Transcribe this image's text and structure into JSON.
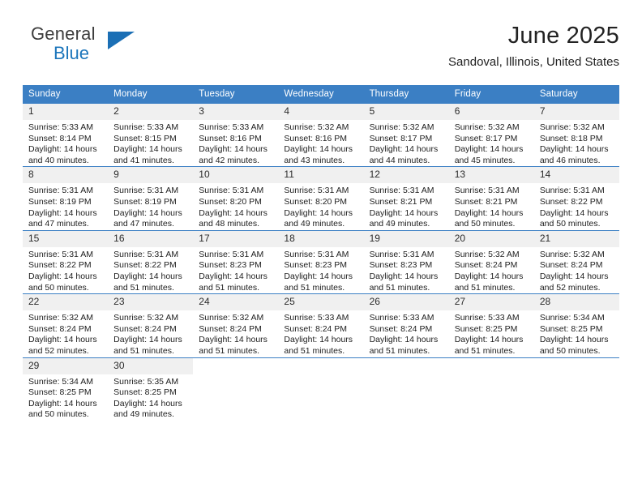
{
  "brand": {
    "line1": "General",
    "line2": "Blue",
    "triangle_color": "#1b6fb5",
    "blue_color": "#1b75bb"
  },
  "header": {
    "title": "June 2025",
    "location": "Sandoval, Illinois, United States"
  },
  "theme": {
    "header_bg": "#3b7fc4",
    "header_text": "#ffffff",
    "daynum_bg": "#f0f0f0",
    "page_bg": "#ffffff",
    "body_text": "#1d1d1d"
  },
  "weekday_headers": [
    "Sunday",
    "Monday",
    "Tuesday",
    "Wednesday",
    "Thursday",
    "Friday",
    "Saturday"
  ],
  "weeks": [
    [
      {
        "day": "1",
        "sunrise": "Sunrise: 5:33 AM",
        "sunset": "Sunset: 8:14 PM",
        "daylight_line1": "Daylight: 14 hours",
        "daylight_line2": "and 40 minutes."
      },
      {
        "day": "2",
        "sunrise": "Sunrise: 5:33 AM",
        "sunset": "Sunset: 8:15 PM",
        "daylight_line1": "Daylight: 14 hours",
        "daylight_line2": "and 41 minutes."
      },
      {
        "day": "3",
        "sunrise": "Sunrise: 5:33 AM",
        "sunset": "Sunset: 8:16 PM",
        "daylight_line1": "Daylight: 14 hours",
        "daylight_line2": "and 42 minutes."
      },
      {
        "day": "4",
        "sunrise": "Sunrise: 5:32 AM",
        "sunset": "Sunset: 8:16 PM",
        "daylight_line1": "Daylight: 14 hours",
        "daylight_line2": "and 43 minutes."
      },
      {
        "day": "5",
        "sunrise": "Sunrise: 5:32 AM",
        "sunset": "Sunset: 8:17 PM",
        "daylight_line1": "Daylight: 14 hours",
        "daylight_line2": "and 44 minutes."
      },
      {
        "day": "6",
        "sunrise": "Sunrise: 5:32 AM",
        "sunset": "Sunset: 8:17 PM",
        "daylight_line1": "Daylight: 14 hours",
        "daylight_line2": "and 45 minutes."
      },
      {
        "day": "7",
        "sunrise": "Sunrise: 5:32 AM",
        "sunset": "Sunset: 8:18 PM",
        "daylight_line1": "Daylight: 14 hours",
        "daylight_line2": "and 46 minutes."
      }
    ],
    [
      {
        "day": "8",
        "sunrise": "Sunrise: 5:31 AM",
        "sunset": "Sunset: 8:19 PM",
        "daylight_line1": "Daylight: 14 hours",
        "daylight_line2": "and 47 minutes."
      },
      {
        "day": "9",
        "sunrise": "Sunrise: 5:31 AM",
        "sunset": "Sunset: 8:19 PM",
        "daylight_line1": "Daylight: 14 hours",
        "daylight_line2": "and 47 minutes."
      },
      {
        "day": "10",
        "sunrise": "Sunrise: 5:31 AM",
        "sunset": "Sunset: 8:20 PM",
        "daylight_line1": "Daylight: 14 hours",
        "daylight_line2": "and 48 minutes."
      },
      {
        "day": "11",
        "sunrise": "Sunrise: 5:31 AM",
        "sunset": "Sunset: 8:20 PM",
        "daylight_line1": "Daylight: 14 hours",
        "daylight_line2": "and 49 minutes."
      },
      {
        "day": "12",
        "sunrise": "Sunrise: 5:31 AM",
        "sunset": "Sunset: 8:21 PM",
        "daylight_line1": "Daylight: 14 hours",
        "daylight_line2": "and 49 minutes."
      },
      {
        "day": "13",
        "sunrise": "Sunrise: 5:31 AM",
        "sunset": "Sunset: 8:21 PM",
        "daylight_line1": "Daylight: 14 hours",
        "daylight_line2": "and 50 minutes."
      },
      {
        "day": "14",
        "sunrise": "Sunrise: 5:31 AM",
        "sunset": "Sunset: 8:22 PM",
        "daylight_line1": "Daylight: 14 hours",
        "daylight_line2": "and 50 minutes."
      }
    ],
    [
      {
        "day": "15",
        "sunrise": "Sunrise: 5:31 AM",
        "sunset": "Sunset: 8:22 PM",
        "daylight_line1": "Daylight: 14 hours",
        "daylight_line2": "and 50 minutes."
      },
      {
        "day": "16",
        "sunrise": "Sunrise: 5:31 AM",
        "sunset": "Sunset: 8:22 PM",
        "daylight_line1": "Daylight: 14 hours",
        "daylight_line2": "and 51 minutes."
      },
      {
        "day": "17",
        "sunrise": "Sunrise: 5:31 AM",
        "sunset": "Sunset: 8:23 PM",
        "daylight_line1": "Daylight: 14 hours",
        "daylight_line2": "and 51 minutes."
      },
      {
        "day": "18",
        "sunrise": "Sunrise: 5:31 AM",
        "sunset": "Sunset: 8:23 PM",
        "daylight_line1": "Daylight: 14 hours",
        "daylight_line2": "and 51 minutes."
      },
      {
        "day": "19",
        "sunrise": "Sunrise: 5:31 AM",
        "sunset": "Sunset: 8:23 PM",
        "daylight_line1": "Daylight: 14 hours",
        "daylight_line2": "and 51 minutes."
      },
      {
        "day": "20",
        "sunrise": "Sunrise: 5:32 AM",
        "sunset": "Sunset: 8:24 PM",
        "daylight_line1": "Daylight: 14 hours",
        "daylight_line2": "and 51 minutes."
      },
      {
        "day": "21",
        "sunrise": "Sunrise: 5:32 AM",
        "sunset": "Sunset: 8:24 PM",
        "daylight_line1": "Daylight: 14 hours",
        "daylight_line2": "and 52 minutes."
      }
    ],
    [
      {
        "day": "22",
        "sunrise": "Sunrise: 5:32 AM",
        "sunset": "Sunset: 8:24 PM",
        "daylight_line1": "Daylight: 14 hours",
        "daylight_line2": "and 52 minutes."
      },
      {
        "day": "23",
        "sunrise": "Sunrise: 5:32 AM",
        "sunset": "Sunset: 8:24 PM",
        "daylight_line1": "Daylight: 14 hours",
        "daylight_line2": "and 51 minutes."
      },
      {
        "day": "24",
        "sunrise": "Sunrise: 5:32 AM",
        "sunset": "Sunset: 8:24 PM",
        "daylight_line1": "Daylight: 14 hours",
        "daylight_line2": "and 51 minutes."
      },
      {
        "day": "25",
        "sunrise": "Sunrise: 5:33 AM",
        "sunset": "Sunset: 8:24 PM",
        "daylight_line1": "Daylight: 14 hours",
        "daylight_line2": "and 51 minutes."
      },
      {
        "day": "26",
        "sunrise": "Sunrise: 5:33 AM",
        "sunset": "Sunset: 8:24 PM",
        "daylight_line1": "Daylight: 14 hours",
        "daylight_line2": "and 51 minutes."
      },
      {
        "day": "27",
        "sunrise": "Sunrise: 5:33 AM",
        "sunset": "Sunset: 8:25 PM",
        "daylight_line1": "Daylight: 14 hours",
        "daylight_line2": "and 51 minutes."
      },
      {
        "day": "28",
        "sunrise": "Sunrise: 5:34 AM",
        "sunset": "Sunset: 8:25 PM",
        "daylight_line1": "Daylight: 14 hours",
        "daylight_line2": "and 50 minutes."
      }
    ],
    [
      {
        "day": "29",
        "sunrise": "Sunrise: 5:34 AM",
        "sunset": "Sunset: 8:25 PM",
        "daylight_line1": "Daylight: 14 hours",
        "daylight_line2": "and 50 minutes."
      },
      {
        "day": "30",
        "sunrise": "Sunrise: 5:35 AM",
        "sunset": "Sunset: 8:25 PM",
        "daylight_line1": "Daylight: 14 hours",
        "daylight_line2": "and 49 minutes."
      },
      null,
      null,
      null,
      null,
      null
    ]
  ]
}
